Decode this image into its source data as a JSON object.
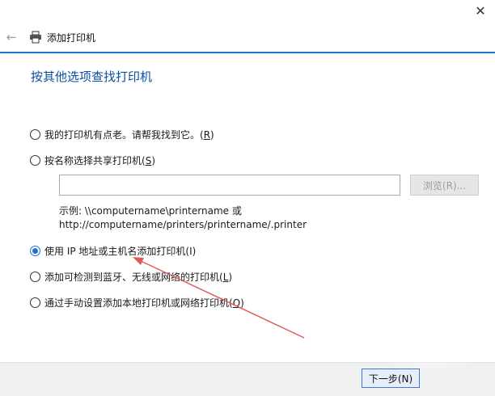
{
  "window": {
    "title": "添加打印机",
    "close_glyph": "✕",
    "back_glyph": "←"
  },
  "heading": "按其他选项查找打印机",
  "options": [
    {
      "label": "我的打印机有点老。请帮我找到它。(",
      "key": "R",
      "suffix": ")"
    },
    {
      "label": "按名称选择共享打印机(",
      "key": "S",
      "suffix": ")"
    },
    {
      "label": "使用 IP 地址或主机名添加打印机(I)",
      "key": "",
      "suffix": ""
    },
    {
      "label": "添加可检测到蓝牙、无线或网络的打印机(",
      "key": "L",
      "suffix": ")"
    },
    {
      "label": "通过手动设置添加本地打印机或网络打印机(",
      "key": "O",
      "suffix": ")"
    }
  ],
  "share_field": {
    "value": ""
  },
  "browse_button": "浏览(R)...",
  "example_line1": "示例: \\\\computername\\printername 或",
  "example_line2": "http://computername/printers/printername/.printer",
  "next_button": "下一步(N)",
  "colors": {
    "accent": "#1a75d2",
    "heading": "#0b4fa1",
    "annotation_arrow": "#e05a5a"
  }
}
